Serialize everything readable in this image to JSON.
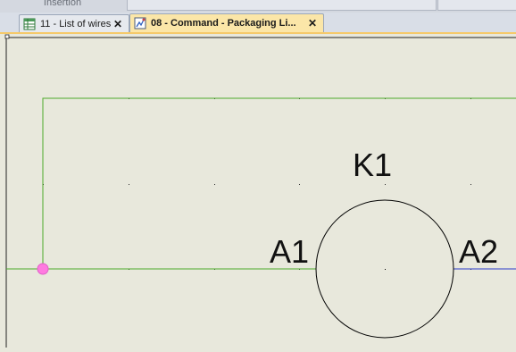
{
  "ribbon": {
    "group_label": "Insertion"
  },
  "tabs": [
    {
      "label": "11 - List of wires",
      "icon": "table-icon",
      "close": "✕",
      "active": false
    },
    {
      "label": "08 - Command - Packaging Li...",
      "icon": "schematic-icon",
      "close": "✕",
      "active": true
    }
  ],
  "schematic": {
    "component_tag": "K1",
    "terminal_left": "A1",
    "terminal_right": "A2",
    "colors": {
      "background": "#e8e8dc",
      "wire_green": "#4caa2a",
      "wire_blue": "#2c3cc8",
      "junction": "#ff7ae0",
      "symbol": "#000000"
    }
  }
}
